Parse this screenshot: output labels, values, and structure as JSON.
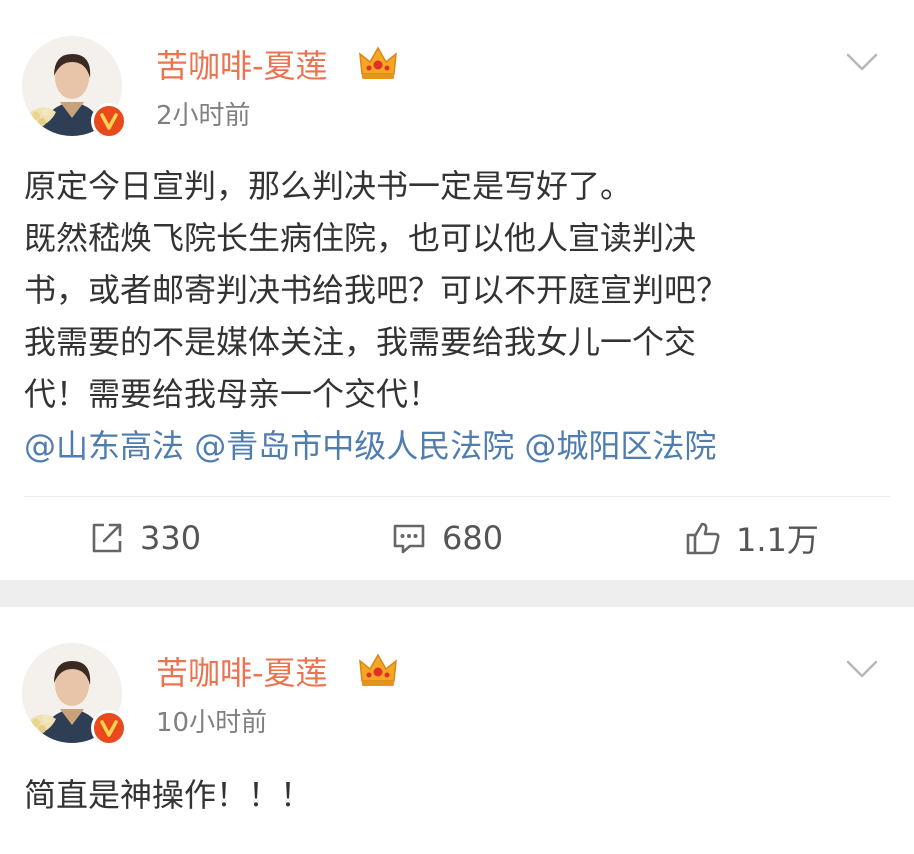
{
  "posts": [
    {
      "username": "苦咖啡-夏莲",
      "timestamp": "2小时前",
      "body_lines": [
        "原定今日宣判，那么判决书一定是写好了。",
        "既然嵇焕飞院长生病住院，也可以他人宣读判决",
        "书，或者邮寄判决书给我吧？可以不开庭宣判吧？",
        "我需要的不是媒体关注，我需要给我女儿一个交",
        "代！需要给我母亲一个交代！"
      ],
      "mentions": [
        "@山东高法",
        "@青岛市中级人民法院",
        "@城阳区法院"
      ],
      "actions": {
        "repost_count": "330",
        "comment_count": "680",
        "like_count": "1.1万"
      }
    },
    {
      "username": "苦咖啡-夏莲",
      "timestamp": "10小时前",
      "body_lines": [
        "简直是神操作！！！"
      ]
    }
  ],
  "icons": {
    "crown": "crown-icon",
    "verified": "verified-badge-icon",
    "menu": "chevron-down-icon",
    "repost": "repost-icon",
    "comment": "comment-icon",
    "like": "like-icon"
  },
  "colors": {
    "username": "#eb7350",
    "mention": "#507daf",
    "body_text": "#333333",
    "timestamp": "#808080",
    "verified_badge": "#e8491d",
    "separator": "#eeeeee"
  }
}
